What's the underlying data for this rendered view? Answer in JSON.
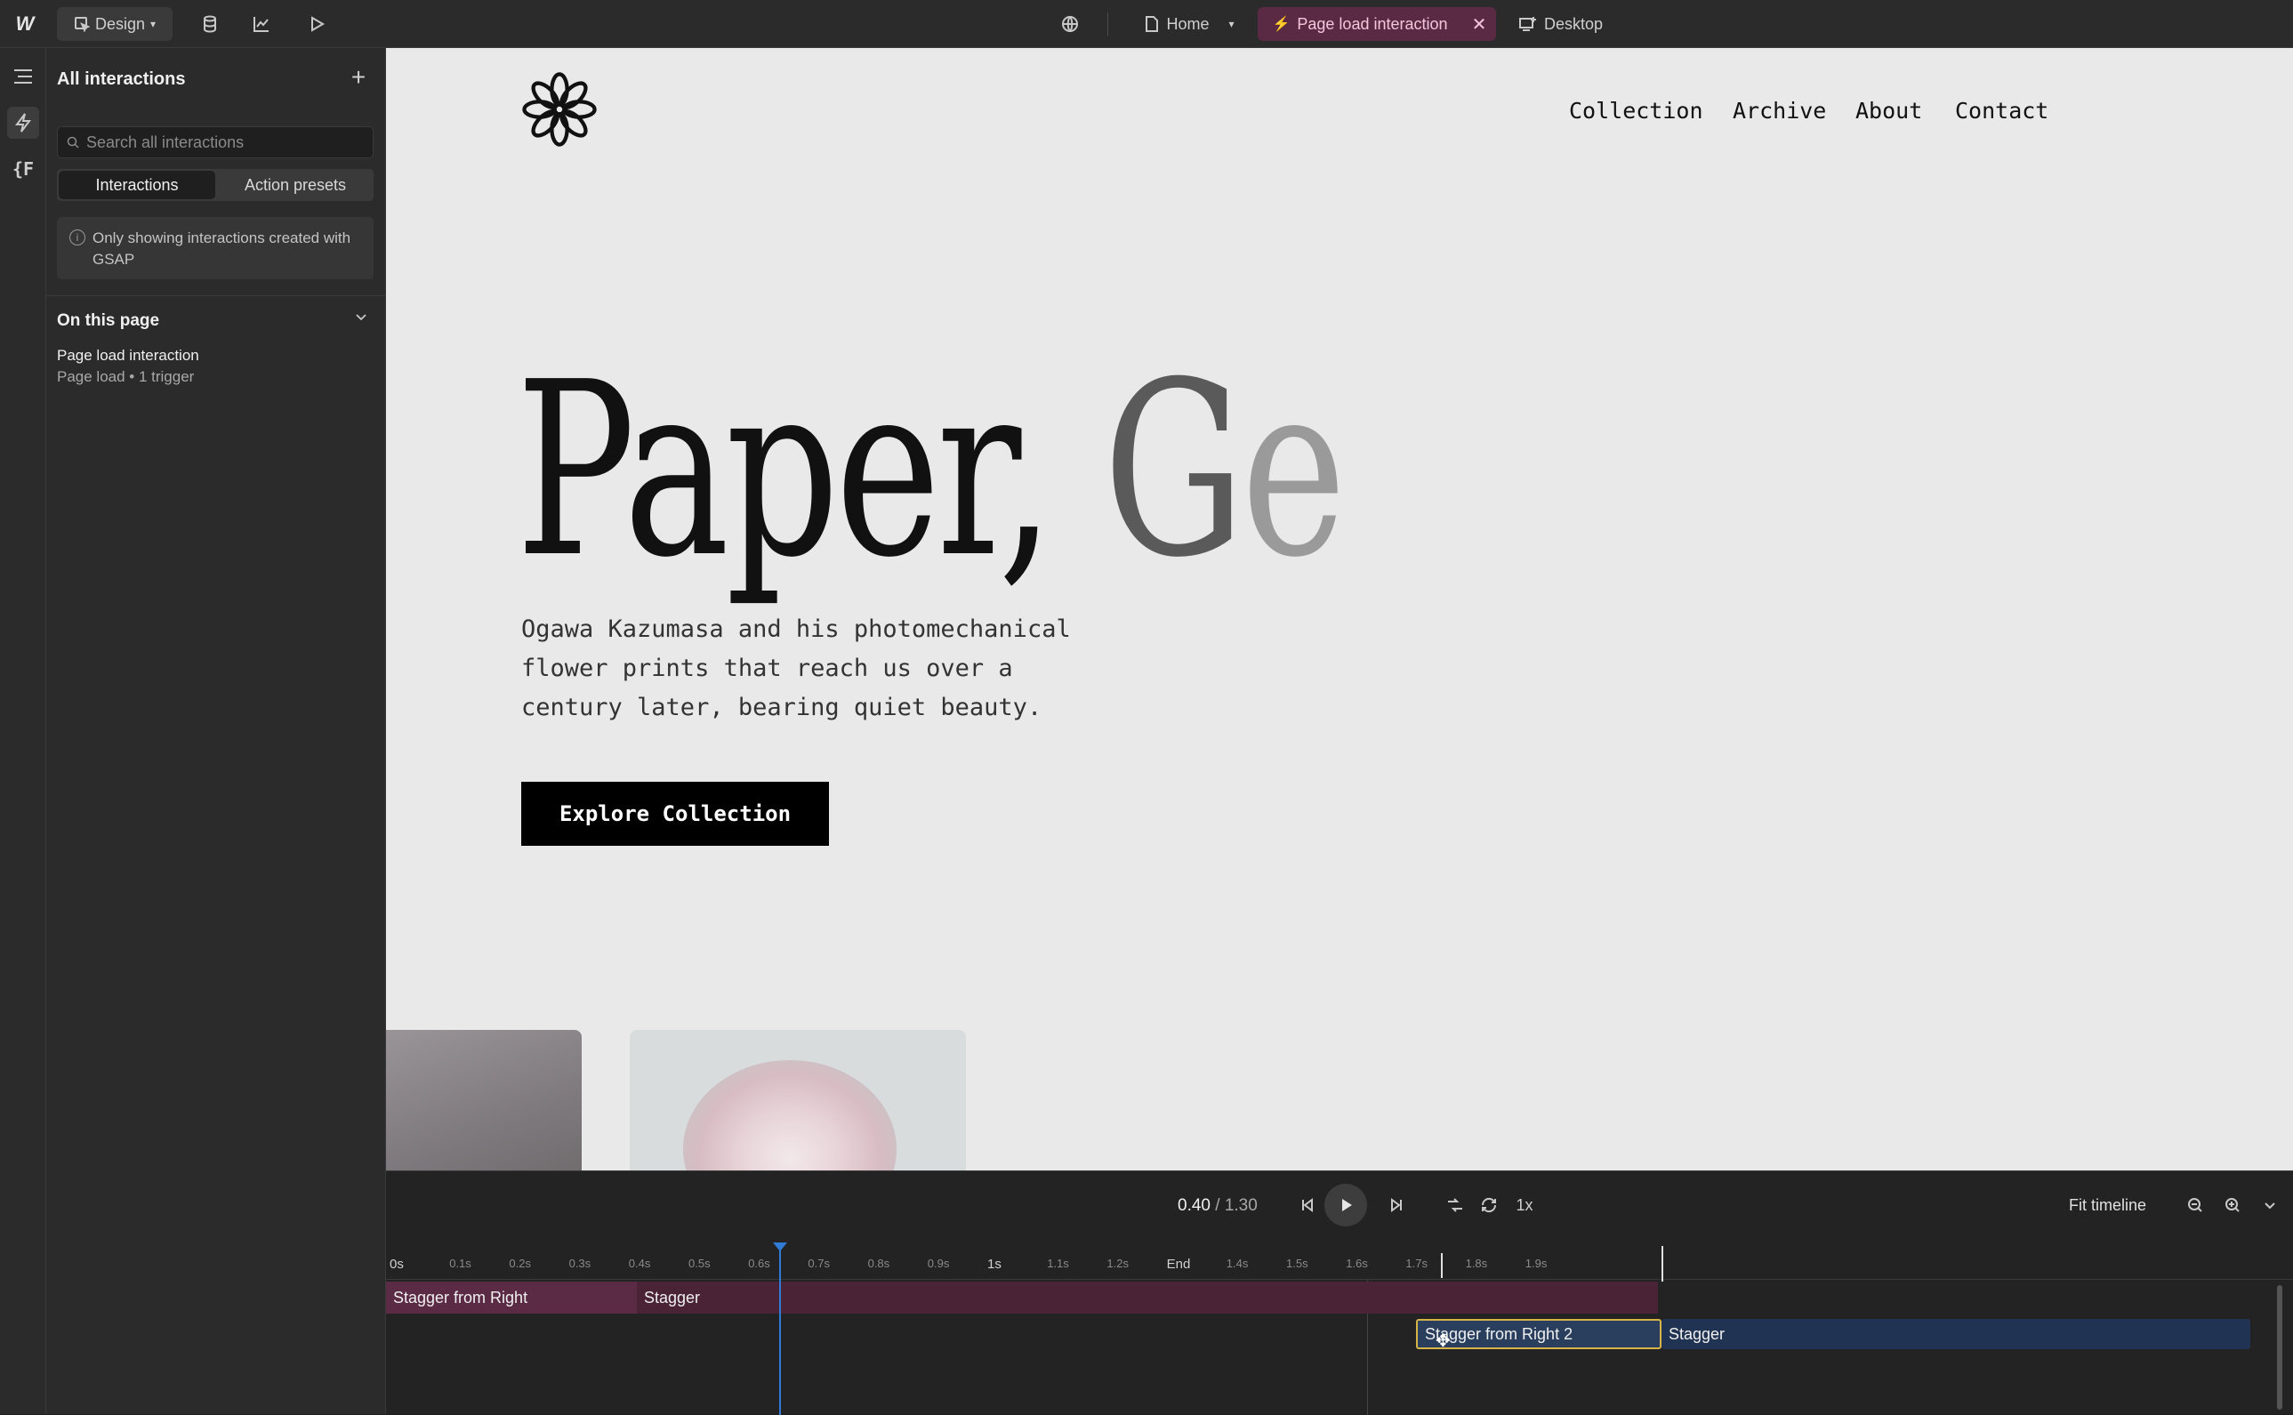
{
  "topbar": {
    "logo_label": "W",
    "mode_label": "Design",
    "page_label": "Home",
    "interaction_label": "Page load interaction",
    "breakpoint_label": "Desktop"
  },
  "rail": {
    "fx_label": "{F"
  },
  "panel": {
    "title": "All interactions",
    "search_placeholder": "Search all interactions",
    "tabs": [
      "Interactions",
      "Action presets"
    ],
    "notice": "Only showing interactions created with GSAP",
    "section_title": "On this page",
    "item_title": "Page load interaction",
    "item_sub": "Page load • 1 trigger"
  },
  "site": {
    "nav": [
      "Collection",
      "Archive",
      "About",
      "Contact"
    ],
    "hero_main": "Paper, ",
    "hero_fade1": "G",
    "hero_fade2": "e",
    "intro": "Ogawa Kazumasa and his photomechanical flower prints that reach us over a century later, bearing quiet beauty.",
    "cta": "Explore Collection"
  },
  "timeline": {
    "current_time": "0.40",
    "total_time": "/ 1.30",
    "speed": "1x",
    "fit_label": "Fit timeline",
    "ticks": [
      "0s",
      "0.1s",
      "0.2s",
      "0.3s",
      "0.4s",
      "0.5s",
      "0.6s",
      "0.7s",
      "0.8s",
      "0.9s",
      "1s",
      "1.1s",
      "1.2s",
      "End",
      "1.4s",
      "1.5s",
      "1.6s",
      "1.7s",
      "1.8s",
      "1.9s"
    ],
    "tracks": {
      "pink_a": "Stagger from Right",
      "pink_b": "Stagger",
      "blue_a": "Stagger from Right 2",
      "blue_b": "Stagger"
    },
    "playhead_time": 0.4
  },
  "colors": {
    "accent_pink": "#5a2a44",
    "playhead_blue": "#2f7bd6",
    "selection_yellow": "#d7b44a"
  }
}
